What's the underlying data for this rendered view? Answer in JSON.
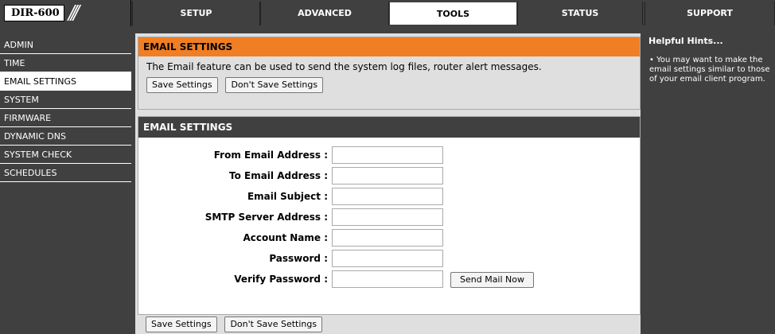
{
  "header": {
    "model": "DIR-600",
    "tabs": [
      {
        "label": "SETUP"
      },
      {
        "label": "ADVANCED"
      },
      {
        "label": "TOOLS"
      },
      {
        "label": "STATUS"
      },
      {
        "label": "SUPPORT"
      }
    ],
    "active_tab": "TOOLS"
  },
  "sidebar": {
    "items": [
      {
        "label": "ADMIN"
      },
      {
        "label": "TIME"
      },
      {
        "label": "EMAIL SETTINGS"
      },
      {
        "label": "SYSTEM"
      },
      {
        "label": "FIRMWARE"
      },
      {
        "label": "DYNAMIC DNS"
      },
      {
        "label": "SYSTEM CHECK"
      },
      {
        "label": "SCHEDULES"
      }
    ],
    "active_item": "EMAIL SETTINGS"
  },
  "intro_section": {
    "title": "EMAIL SETTINGS",
    "description": "The Email feature can be used to send the system log files, router alert messages.",
    "save_label": "Save Settings",
    "dont_save_label": "Don't Save Settings"
  },
  "form_section": {
    "title": "EMAIL SETTINGS",
    "fields": [
      {
        "label": "From Email Address :",
        "value": ""
      },
      {
        "label": "To Email Address :",
        "value": ""
      },
      {
        "label": "Email Subject :",
        "value": ""
      },
      {
        "label": "SMTP Server Address :",
        "value": ""
      },
      {
        "label": "Account Name :",
        "value": ""
      },
      {
        "label": "Password :",
        "value": ""
      },
      {
        "label": "Verify Password :",
        "value": ""
      }
    ],
    "send_label": "Send Mail Now"
  },
  "bottom_buttons": {
    "save_label": "Save Settings",
    "dont_save_label": "Don't Save Settings"
  },
  "hints": {
    "title": "Helpful Hints...",
    "body": "• You may want to make the email settings similar to those of your email client program."
  },
  "colors": {
    "background": "#404040",
    "accent_orange": "#f07e24",
    "panel_gray": "#dfdfdf"
  }
}
